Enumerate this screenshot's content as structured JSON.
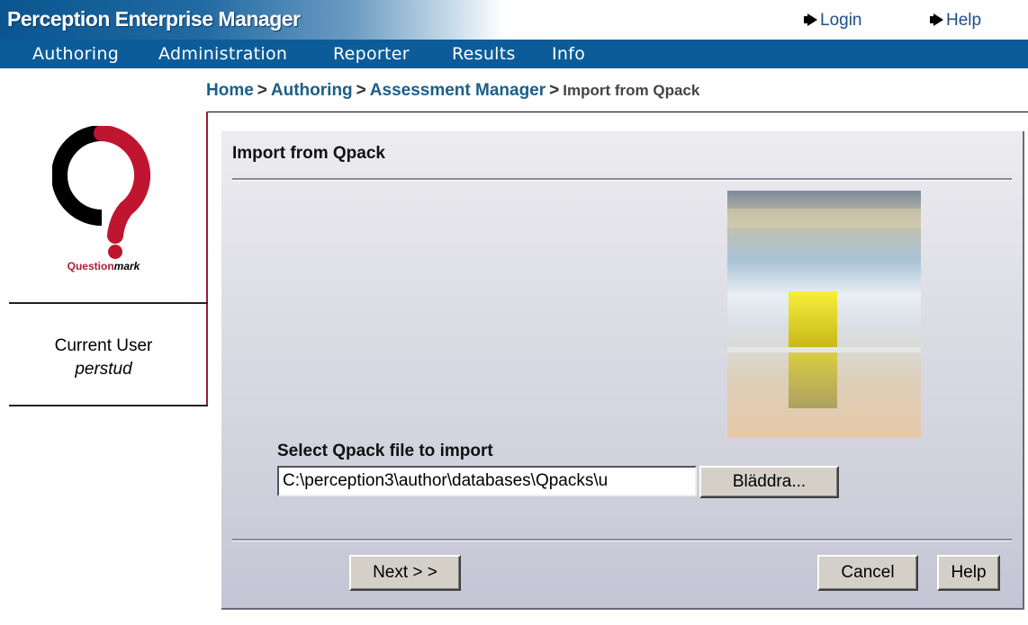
{
  "header": {
    "app_title": "Perception Enterprise Manager",
    "links": [
      {
        "label": "Login"
      },
      {
        "label": "Help"
      }
    ]
  },
  "nav": {
    "items": [
      {
        "label": "Authoring"
      },
      {
        "label": "Administration"
      },
      {
        "label": "Reporter"
      },
      {
        "label": "Results"
      },
      {
        "label": "Info"
      }
    ]
  },
  "breadcrumb": {
    "home": "Home",
    "authoring": "Authoring",
    "assessment_manager": "Assessment Manager",
    "current": "Import from Qpack",
    "separator": ">"
  },
  "sidebar": {
    "logo_brand": "Question",
    "logo_brand_suffix": "mark",
    "current_user_label": "Current User",
    "current_user_name": "perstud"
  },
  "panel": {
    "title": "Import from Qpack",
    "select_label": "Select Qpack file to import",
    "file_path": "C:\\perception3\\author\\databases\\Qpacks\\u",
    "browse_label": "Bläddra...",
    "next_label": "Next > >",
    "cancel_label": "Cancel",
    "help_label": "Help"
  },
  "colors": {
    "nav_bg": "#0c5c99",
    "brand_red": "#b01c35",
    "link_blue": "#1a5f8a"
  },
  "icons": {
    "login": "arrow-right-icon",
    "help": "arrow-right-icon"
  }
}
